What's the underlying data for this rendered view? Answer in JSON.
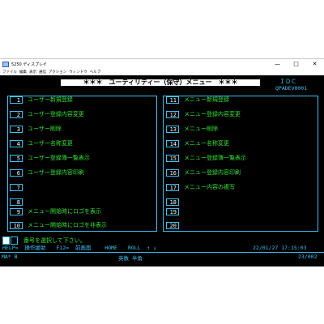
{
  "window": {
    "title": "5250 ディスプレイ",
    "icon": "terminal-icon",
    "controls": {
      "minimize": "—",
      "maximize": "□",
      "close": "✕"
    }
  },
  "menubar": [
    "ファイル",
    "編集",
    "表示",
    "通信",
    "アクション",
    "ウィンドウ",
    "ヘルプ"
  ],
  "screen": {
    "header": "＊＊＊　ユーティリティー（保守）メニュー　＊＊＊",
    "company": "ＩＤＣ",
    "screen_id": "QPADEV0001",
    "left_items": [
      {
        "num": "1",
        "label": "ユーザー新規登録"
      },
      {
        "num": "2",
        "label": "ユーザー登録内容変更"
      },
      {
        "num": "3",
        "label": "ユーザー削除"
      },
      {
        "num": "4",
        "label": "ユーザー名称変更"
      },
      {
        "num": "5",
        "label": "ユーザー登録簿一覧表示"
      },
      {
        "num": "6",
        "label": "ユーザー登録内容印刷"
      },
      {
        "num": "7",
        "label": ""
      },
      {
        "num": "8",
        "label": ""
      },
      {
        "num": "9",
        "label": "メニュー開始時にロゴを表示"
      },
      {
        "num": "10",
        "label": "メニュー開始時にロゴを非表示"
      }
    ],
    "right_items": [
      {
        "num": "11",
        "label": "メニュー新規登録"
      },
      {
        "num": "12",
        "label": "メニュー登録内容変更"
      },
      {
        "num": "13",
        "label": "メニュー削除"
      },
      {
        "num": "14",
        "label": "メニュー名称変更"
      },
      {
        "num": "15",
        "label": "メニュー登録簿一覧表示"
      },
      {
        "num": "16",
        "label": "メニュー登録内容印刷"
      },
      {
        "num": "17",
        "label": "メニュー内容の複写"
      },
      {
        "num": "18",
        "label": ""
      },
      {
        "num": "19",
        "label": ""
      },
      {
        "num": "20",
        "label": ""
      }
    ],
    "prompt": "番号を選択して下さい。",
    "function_keys": "HELP=  操作援助　　F12=  前画面　　 HOME　　ROLL  ↑ ↓",
    "timestamp": "22/01/27 17:15:03",
    "status": {
      "ma": "MA*   B",
      "mode": "英数  半角",
      "position": "23/002"
    }
  },
  "colors": {
    "cyan": "#3ec3f3",
    "green": "#35e235",
    "white": "#ffffff",
    "background": "#000000"
  }
}
